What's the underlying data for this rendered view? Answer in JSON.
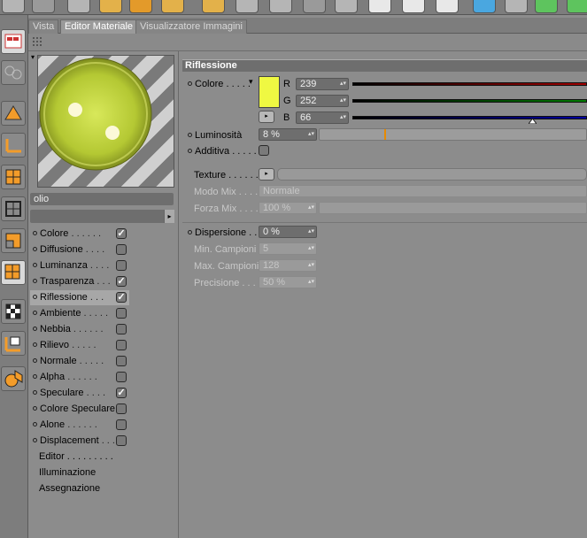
{
  "tabs": [
    {
      "label": "Vista"
    },
    {
      "label": "Editor Materiale"
    },
    {
      "label": "Visualizzatore Immagini"
    }
  ],
  "material": {
    "name": "olio"
  },
  "channels": [
    {
      "label": "Colore",
      "checked": true
    },
    {
      "label": "Diffusione",
      "checked": false
    },
    {
      "label": "Luminanza",
      "checked": false
    },
    {
      "label": "Trasparenza",
      "checked": true
    },
    {
      "label": "Riflessione",
      "checked": true,
      "selected": true
    },
    {
      "label": "Ambiente",
      "checked": false
    },
    {
      "label": "Nebbia",
      "checked": false
    },
    {
      "label": "Rilievo",
      "checked": false
    },
    {
      "label": "Normale",
      "checked": false
    },
    {
      "label": "Alpha",
      "checked": false
    },
    {
      "label": "Speculare",
      "checked": true
    },
    {
      "label": "Colore Speculare",
      "checked": false
    },
    {
      "label": "Alone",
      "checked": false
    },
    {
      "label": "Displacement",
      "checked": false
    }
  ],
  "extra_items": [
    "Editor",
    "Illuminazione",
    "Assegnazione"
  ],
  "section_title": "Riflessione",
  "color": {
    "label": "Colore",
    "r_label": "R",
    "r": "239",
    "g_label": "G",
    "g": "252",
    "b_label": "B",
    "b": "66",
    "swatch": "#eff842"
  },
  "luminosity": {
    "label": "Luminosità",
    "value": "8 %",
    "fraction": 0.08
  },
  "additive": {
    "label": "Additiva",
    "checked": false
  },
  "texture": {
    "label": "Texture"
  },
  "mix_mode": {
    "label": "Modo Mix",
    "value": "Normale"
  },
  "mix_strength": {
    "label": "Forza Mix",
    "value": "100 %"
  },
  "dispersion": {
    "label": "Dispersione",
    "value": "0 %"
  },
  "min_samples": {
    "label": "Min. Campioni",
    "value": "5"
  },
  "max_samples": {
    "label": "Max. Campioni",
    "value": "128"
  },
  "precision": {
    "label": "Precisione",
    "value": "50 %"
  },
  "icons": {
    "arrow": "▸",
    "spin": "▴▾",
    "check": "✓",
    "menu": "▾"
  }
}
